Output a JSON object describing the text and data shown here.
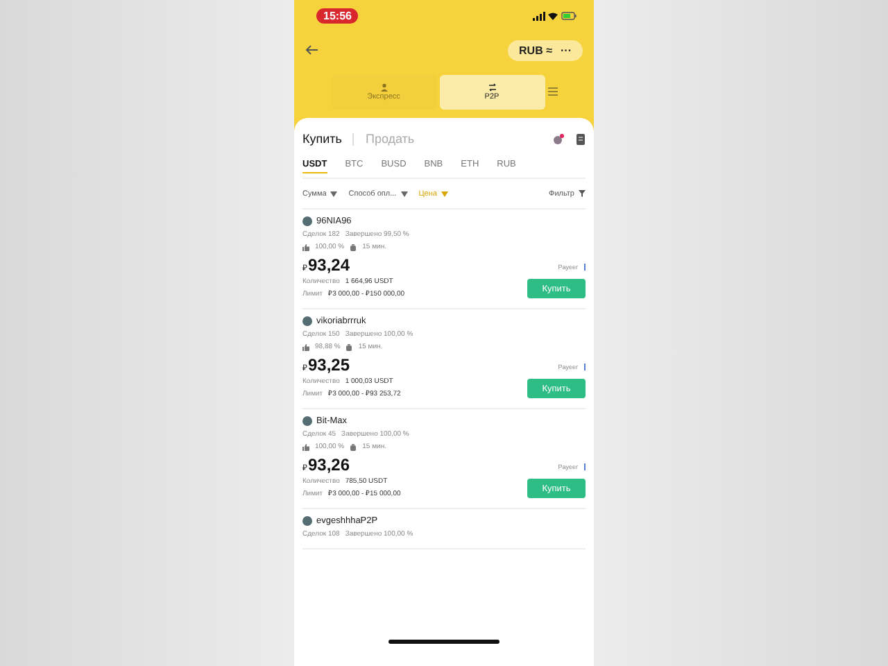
{
  "status_bar": {
    "time": "15:56"
  },
  "header": {
    "currency": "RUB",
    "currency_icon": "≈",
    "more": "···"
  },
  "modes": [
    {
      "label": "Экспресс",
      "selected": false,
      "kind": "person"
    },
    {
      "label": "P2P",
      "selected": true,
      "kind": "p2p"
    }
  ],
  "trade_tabs": [
    {
      "label": "Купить",
      "selected": true
    },
    {
      "label": "Продать",
      "selected": false
    }
  ],
  "assets": [
    {
      "label": "USDT",
      "selected": true
    },
    {
      "label": "BTC",
      "selected": false
    },
    {
      "label": "BUSD",
      "selected": false
    },
    {
      "label": "BNB",
      "selected": false
    },
    {
      "label": "ETH",
      "selected": false
    },
    {
      "label": "RUB",
      "selected": false
    }
  ],
  "filters": [
    {
      "label": "Сумма",
      "active": false
    },
    {
      "label": "Способ опл...",
      "active": false
    },
    {
      "label": "Цена",
      "active": true
    }
  ],
  "filter_button": "Фильтр",
  "offers": [
    {
      "name": "96NIA96",
      "deals": "Сделок 182",
      "completed": "Завершено 99,50 %",
      "rating": "100,00 %",
      "time": "15 мин.",
      "currency_sign": "₽",
      "price": "93,24",
      "quantity_label": "Количество",
      "quantity": "1 664,96  USDT",
      "limit_label": "Лимит",
      "limit": "₽3 000,00 - ₽150 000,00",
      "payment": "Payeer",
      "button": "Купить"
    },
    {
      "name": "vikoriabrrruk",
      "deals": "Сделок 150",
      "completed": "Завершено 100,00 %",
      "rating": "98,88 %",
      "time": "15 мин.",
      "currency_sign": "₽",
      "price": "93,25",
      "quantity_label": "Количество",
      "quantity": "1 000,03  USDT",
      "limit_label": "Лимит",
      "limit": "₽3 000,00 - ₽93 253,72",
      "payment": "Payeer",
      "button": "Купить"
    },
    {
      "name": "Bit-Max",
      "deals": "Сделок 45",
      "completed": "Завершено 100,00 %",
      "rating": "100,00 %",
      "time": "15 мин.",
      "currency_sign": "₽",
      "price": "93,26",
      "quantity_label": "Количество",
      "quantity": "785,50  USDT",
      "limit_label": "Лимит",
      "limit": "₽3 000,00 - ₽15 000,00",
      "payment": "Payeer",
      "button": "Купить"
    },
    {
      "name": "evgeshhhaP2P",
      "deals": "Сделок 108",
      "completed": "Завершено 100,00 %"
    }
  ]
}
